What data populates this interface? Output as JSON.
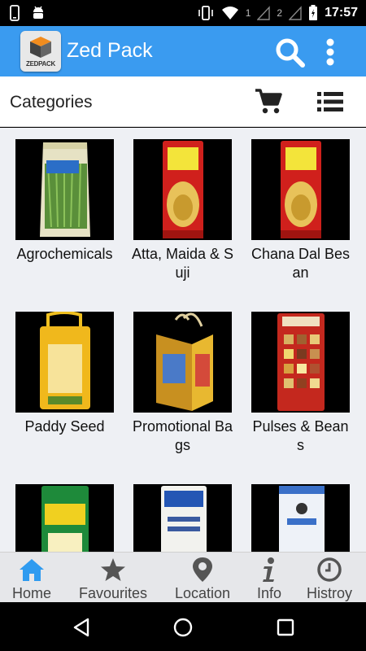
{
  "status_bar": {
    "time": "17:57",
    "sim1": "1",
    "sim2": "2",
    "icons": [
      "phone-icon",
      "android-debug-icon",
      "vibrate-icon",
      "wifi-icon",
      "signal-icon",
      "battery-icon"
    ]
  },
  "app_bar": {
    "logo_text": "ZEDPACK",
    "title": "Zed Pack",
    "color": "#3a9bf0"
  },
  "header": {
    "title": "Categories"
  },
  "categories": [
    {
      "label": "Agrochemicals",
      "bag": "green"
    },
    {
      "label": "Atta, Maida & Suji",
      "bag": "red"
    },
    {
      "label": "Chana Dal Besan",
      "bag": "red"
    },
    {
      "label": "Paddy Seed",
      "bag": "yellow"
    },
    {
      "label": "Promotional Bags",
      "bag": "tote"
    },
    {
      "label": "Pulses & Beans",
      "bag": "red-grains"
    },
    {
      "label": "",
      "bag": "green-avtar"
    },
    {
      "label": "",
      "bag": "white-delco"
    },
    {
      "label": "",
      "bag": "white-blue"
    }
  ],
  "bottom_nav": [
    {
      "label": "Home",
      "icon": "home-icon",
      "active": true
    },
    {
      "label": "Favourites",
      "icon": "star-icon",
      "active": false
    },
    {
      "label": "Location",
      "icon": "location-pin-icon",
      "active": false
    },
    {
      "label": "Info",
      "icon": "info-icon",
      "active": false
    },
    {
      "label": "Histroy",
      "icon": "clock-icon",
      "active": false
    }
  ]
}
